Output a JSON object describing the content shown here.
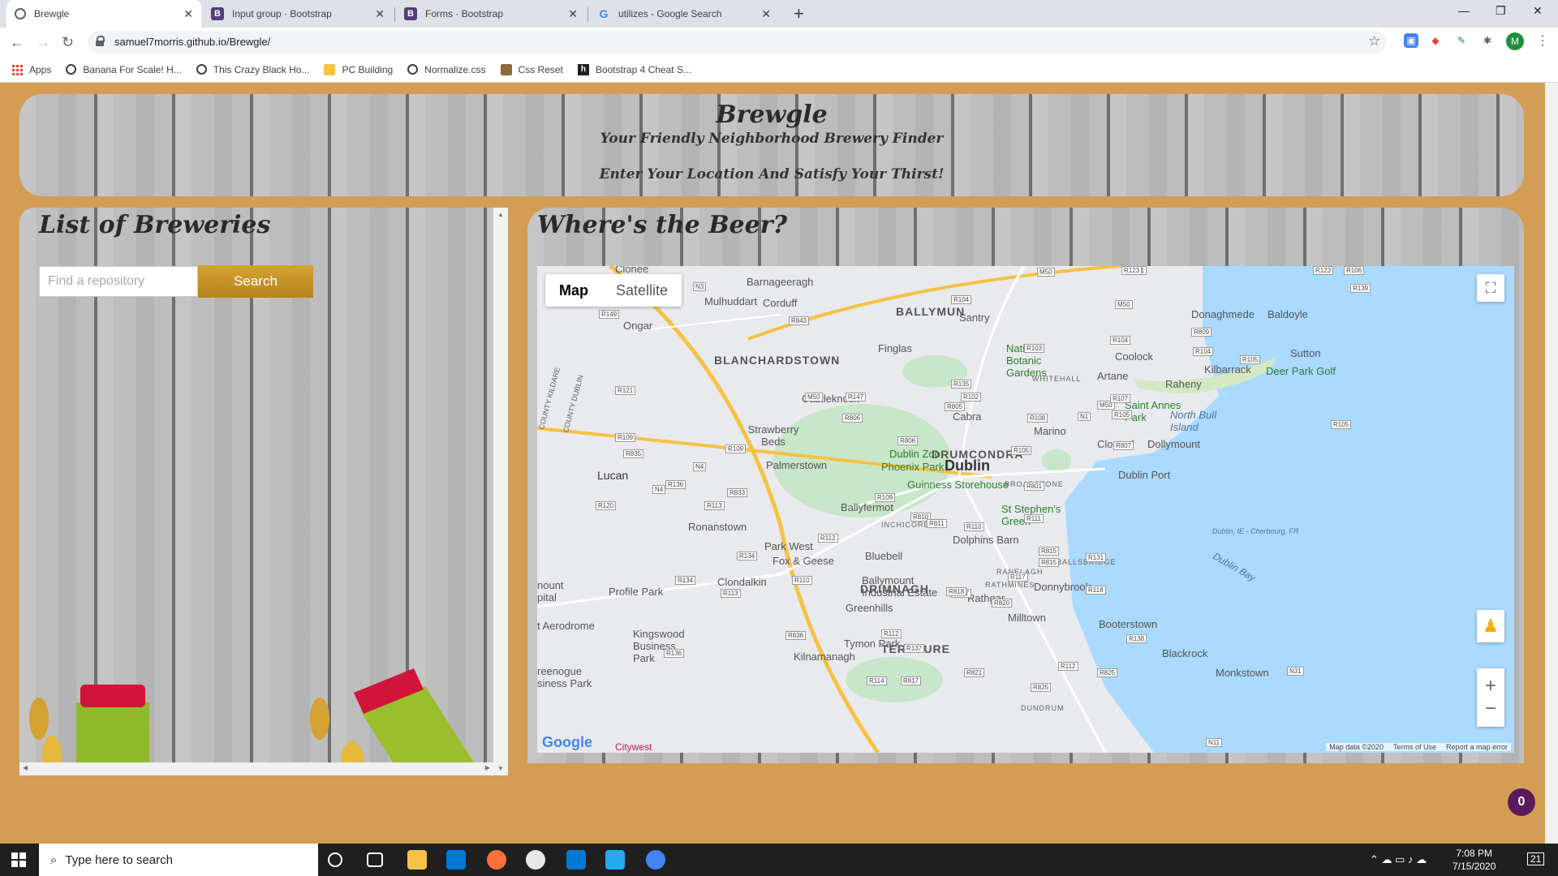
{
  "browser": {
    "tabs": [
      {
        "title": "Brewgle",
        "icon": "globe-icon"
      },
      {
        "title": "Input group · Bootstrap",
        "icon": "bootstrap-icon"
      },
      {
        "title": "Forms · Bootstrap",
        "icon": "bootstrap-icon"
      },
      {
        "title": "utilizes - Google Search",
        "icon": "google-icon"
      }
    ],
    "new_tab": "+",
    "url": "samuel7morris.github.io/Brewgle/",
    "profile_initial": "M",
    "bookmarks": [
      {
        "label": "Apps",
        "icon": "apps-icon"
      },
      {
        "label": "Banana For Scale! H...",
        "icon": "globe-icon"
      },
      {
        "label": "This Crazy Black Ho...",
        "icon": "globe-icon"
      },
      {
        "label": "PC Building",
        "icon": "folder-icon"
      },
      {
        "label": "Normalize.css",
        "icon": "globe-icon"
      },
      {
        "label": "Css Reset",
        "icon": "cake-icon"
      },
      {
        "label": "Bootstrap 4 Cheat S...",
        "icon": "h-icon"
      }
    ]
  },
  "header": {
    "brand": "Brewgle",
    "tagline": "Your Friendly Neighborhood Brewery Finder",
    "tagline2": "Enter Your Location And Satisfy Your Thirst!"
  },
  "left_panel": {
    "title": "List of Breweries",
    "search_placeholder": "Find a repository",
    "search_button": "Search"
  },
  "right_panel": {
    "title": "Where's the Beer?",
    "map": {
      "type_map": "Map",
      "type_satellite": "Satellite",
      "zoom_in": "+",
      "zoom_out": "−",
      "google": "Google",
      "footer": {
        "data": "Map data ©2020",
        "terms": "Terms of Use",
        "report": "Report a map error"
      },
      "labels": {
        "dublin": "Dublin",
        "blanchardstown": "BLANCHARDSTOWN",
        "ballymun": "BALLYMUN",
        "drumcondra": "DRUMCONDRA",
        "drimnagh": "DRIMNAGH",
        "terenure": "TERENURE",
        "lucan": "Lucan",
        "finglas": "Finglas",
        "santry": "Santry",
        "clonee": "Clonee",
        "mulhuddart": "Mulhuddart",
        "corduff": "Corduff",
        "ongar": "Ongar",
        "barnageeragh": "Barnageeragh",
        "castleknock": "Castleknock",
        "cabra": "Cabra",
        "strawberry_beds": "Strawberry Beds",
        "palmerstown": "Palmerstown",
        "ballyfermot": "Ballyfermot",
        "ronanstown": "Ronanstown",
        "park_west": "Park West",
        "fox_geese": "Fox & Geese",
        "bluebell": "Bluebell",
        "clondalkin": "Clondalkin",
        "profile_park": "Profile Park",
        "greenhills": "Greenhills",
        "kingswood": "Kingswood Business Park",
        "tymon": "Tymon Park",
        "kilnamanagh": "Kilnamanagh",
        "rathgar": "Rathgar",
        "milltown": "Milltown",
        "donnybrook": "Donnybrook",
        "booterstown": "Booterstown",
        "blackrock": "Blackrock",
        "monkstown": "Monkstown",
        "marino": "Marino",
        "clontarf": "Clontarf",
        "artane": "Artane",
        "coolock": "Coolock",
        "raheny": "Raheny",
        "kilbarrack": "Kilbarrack",
        "donaghmede": "Donaghmede",
        "baldoyle": "Baldoyle",
        "sutton": "Sutton",
        "dollymount": "Dollymount",
        "saint_annes": "Saint Annes Park",
        "north_bull": "North Bull Island",
        "deer_park": "Deer Park Golf",
        "dublin_port": "Dublin Port",
        "dublin_zoo": "Dublin Zoo",
        "phoenix_park": "Phoenix Park",
        "guinness": "Guinness Storehouse",
        "st_stephens": "St Stephen's Green",
        "national_botanic": "National Botanic Gardens",
        "ballymount": "Ballymount Industrial Estate",
        "aerodrome": "t Aerodrome",
        "greenogue": "reenogue siness Park",
        "mount": "nount pital",
        "dolphins": "Dolphins Barn",
        "broadstone": "BROADSTONE",
        "inchicore": "INCHICORE",
        "ranelagh": "RANELAGH",
        "rathmines": "RATHMINES",
        "ballsbridge": "BALLSBRIDGE",
        "whitehall": "WHITEHALL",
        "dundrum": "DUNDRUM",
        "county_kildare": "COUNTY KILDARE",
        "county_dublin": "COUNTY DUBLIN",
        "dublin_bay": "Dublin Bay",
        "ferry": "Dublin, IE - Cherbourg, FR",
        "citywest": "Citywest"
      },
      "roads": [
        "M50",
        "M50",
        "M50",
        "M50",
        "M1",
        "N3",
        "N4",
        "N4",
        "N1",
        "N11",
        "N31",
        "R104",
        "R139",
        "R123",
        "R123",
        "R106",
        "R149",
        "R843",
        "R103",
        "R135",
        "R102",
        "R805",
        "R147",
        "R806",
        "R108",
        "R121",
        "R109",
        "R835",
        "R109",
        "R806",
        "R833",
        "R136",
        "R113",
        "R120",
        "R109",
        "R810",
        "R811",
        "R110",
        "R112",
        "R134",
        "R110",
        "R113",
        "R134",
        "R838",
        "R112",
        "R136",
        "R137",
        "R114",
        "R817",
        "R821",
        "R825",
        "R112",
        "R138",
        "R131",
        "R815",
        "R117",
        "R118",
        "R820",
        "R817",
        "R105",
        "R105",
        "R105",
        "R107",
        "R809",
        "R104",
        "R104",
        "R105",
        "R807",
        "R801",
        "R111",
        "R815",
        "R818",
        "R825"
      ]
    }
  },
  "chat_badge": "0",
  "taskbar": {
    "search_placeholder": "Type here to search",
    "time": "7:08 PM",
    "date": "7/15/2020",
    "notifications": "21"
  }
}
